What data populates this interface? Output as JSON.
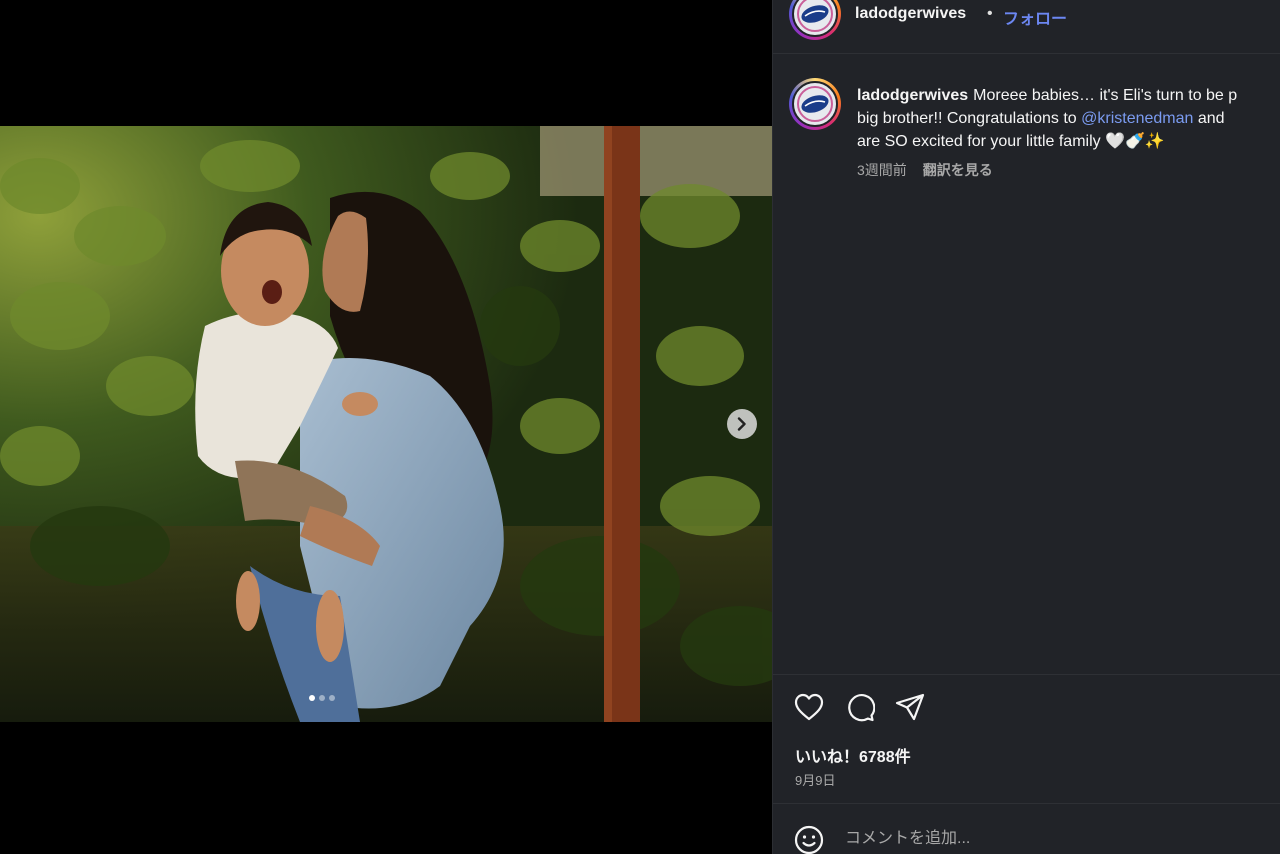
{
  "post": {
    "username": "ladodgerwives",
    "separator": "•",
    "follow_label": "フォロー",
    "caption_part1": "Moreee babies… it's Eli's turn to be p",
    "caption_part2": "big brother!! Congratulations to ",
    "mention": "@kristenedman",
    "caption_part3": " and",
    "caption_part4": "are SO excited for your little family 🤍🍼✨",
    "time_ago": "3週間前",
    "translate_label": "翻訳を見る",
    "likes": "いいね！6788件",
    "date": "9月9日",
    "comment_placeholder": "コメントを追加..."
  },
  "carousel": {
    "current_index": 1,
    "total": 3
  },
  "colors": {
    "panel_bg": "#212328",
    "link": "#6c87f2",
    "mention": "#7b9bf0",
    "muted_text": "#a8a8a8"
  },
  "icons": [
    "dodgers-logo-icon",
    "chevron-right-icon",
    "heart-icon",
    "comment-icon",
    "share-icon",
    "emoji-icon"
  ]
}
